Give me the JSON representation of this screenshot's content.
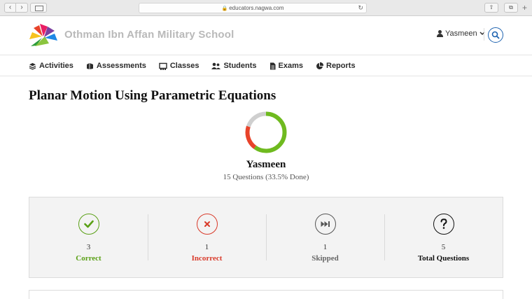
{
  "browser": {
    "url": "educators.nagwa.com"
  },
  "header": {
    "school_name": "Othman Ibn Affan Military School",
    "user_name": "Yasmeen"
  },
  "nav": {
    "items": [
      {
        "label": "Activities",
        "icon": "layers-icon"
      },
      {
        "label": "Assessments",
        "icon": "assessments-icon"
      },
      {
        "label": "Classes",
        "icon": "classes-icon"
      },
      {
        "label": "Students",
        "icon": "students-icon"
      },
      {
        "label": "Exams",
        "icon": "exams-icon"
      },
      {
        "label": "Reports",
        "icon": "reports-icon"
      }
    ]
  },
  "main": {
    "title": "Planar Motion Using Parametric Equations",
    "student_name": "Yasmeen",
    "progress_text": "15 Questions (33.5% Done)",
    "ring": {
      "correct": 3,
      "incorrect": 1,
      "skipped": 1,
      "colors": {
        "correct": "#6fba1f",
        "incorrect": "#e8432a",
        "skipped": "#cfcfcf"
      }
    },
    "stats": [
      {
        "count": "3",
        "label": "Correct",
        "icon": "check-icon",
        "color": "#5aa016"
      },
      {
        "count": "1",
        "label": "Incorrect",
        "icon": "x-icon",
        "color": "#d93a2a"
      },
      {
        "count": "1",
        "label": "Skipped",
        "icon": "skip-icon",
        "color": "#666666"
      },
      {
        "count": "5",
        "label": "Total Questions",
        "icon": "question-icon",
        "color": "#111111"
      }
    ]
  }
}
